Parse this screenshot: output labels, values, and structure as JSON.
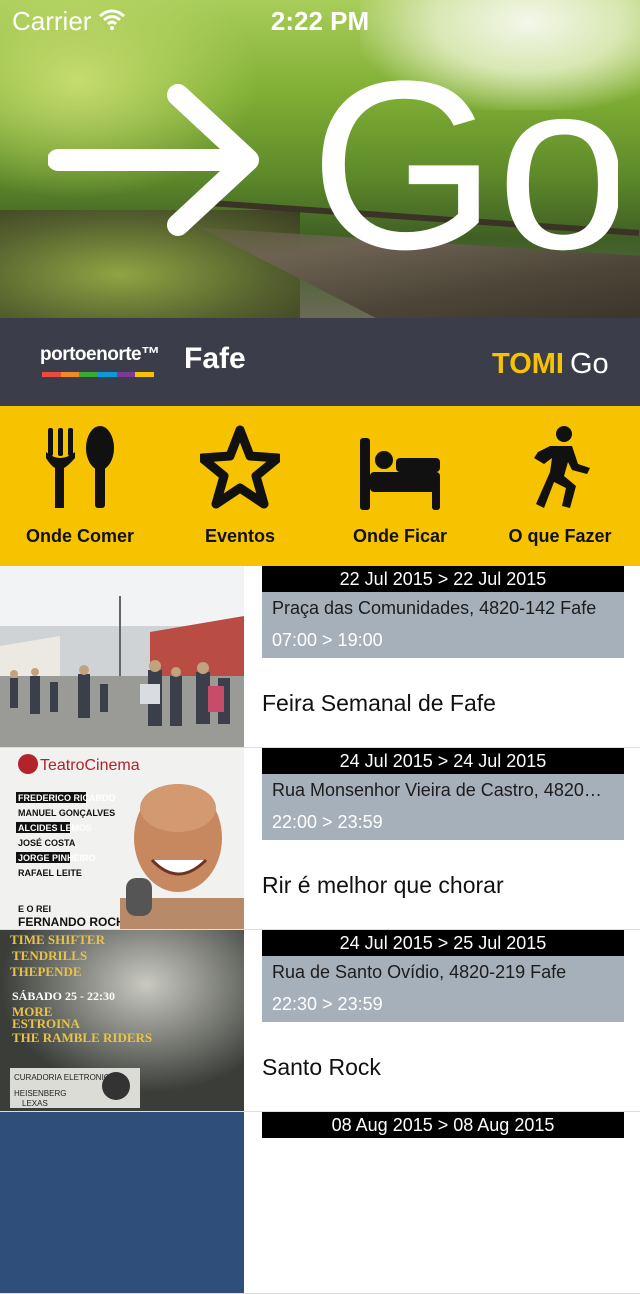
{
  "status_bar": {
    "carrier": "Carrier",
    "time": "2:22 PM"
  },
  "hero": {
    "logo_text": "Go"
  },
  "brand": {
    "porto_logo": "portoenorte™",
    "city": "Fafe",
    "tomi_text": "TOMI",
    "tomi_go": "Go",
    "porto_colors": [
      "#e94b3c",
      "#f08a24",
      "#3aaa35",
      "#0a9ad8",
      "#7b3a96",
      "#f7c300"
    ]
  },
  "categories": [
    {
      "label": "Onde Comer",
      "icon": "fork-spoon-icon"
    },
    {
      "label": "Eventos",
      "icon": "star-icon"
    },
    {
      "label": "Onde Ficar",
      "icon": "bed-icon"
    },
    {
      "label": "O que Fazer",
      "icon": "runner-icon"
    }
  ],
  "events": [
    {
      "date": "22 Jul 2015 > 22 Jul 2015",
      "address": "Praça das Comunidades, 4820-142 Fafe",
      "hours": "07:00 > 19:00",
      "title": "Feira Semanal de Fafe"
    },
    {
      "date": "24 Jul 2015 > 24 Jul 2015",
      "address": "Rua Monsenhor Vieira de Castro, 4820…",
      "hours": "22:00 > 23:59",
      "title": "Rir é melhor que chorar",
      "poster": {
        "brand": "TeatroCinema",
        "names": [
          "FREDERICO RICARDO",
          "MANUEL GONÇALVES",
          "ALCIDES LEMOS",
          "JOSÉ COSTA",
          "JORGE PINHEIRO",
          "RAFAEL LEITE"
        ],
        "footer": "E O REI",
        "star": "FERNANDO ROCHA"
      }
    },
    {
      "date": "24 Jul 2015 > 25 Jul 2015",
      "address": "Rua de Santo Ovídio, 4820-219 Fafe",
      "hours": "22:30 > 23:59",
      "title": "Santo Rock",
      "poster": {
        "lines": [
          "TIME SHIFTER",
          "TENDRILLS",
          "THEPENDE",
          "SÁBADO 25 - 22:30",
          "MORE",
          "ESTROINA",
          "THE RAMBLE RIDERS"
        ],
        "footer": "CURADORIA ELETRONICA",
        "footer2": "HEISENBERG",
        "footer3": "LEXAS"
      }
    },
    {
      "date": "08 Aug 2015 > 08 Aug 2015"
    }
  ]
}
